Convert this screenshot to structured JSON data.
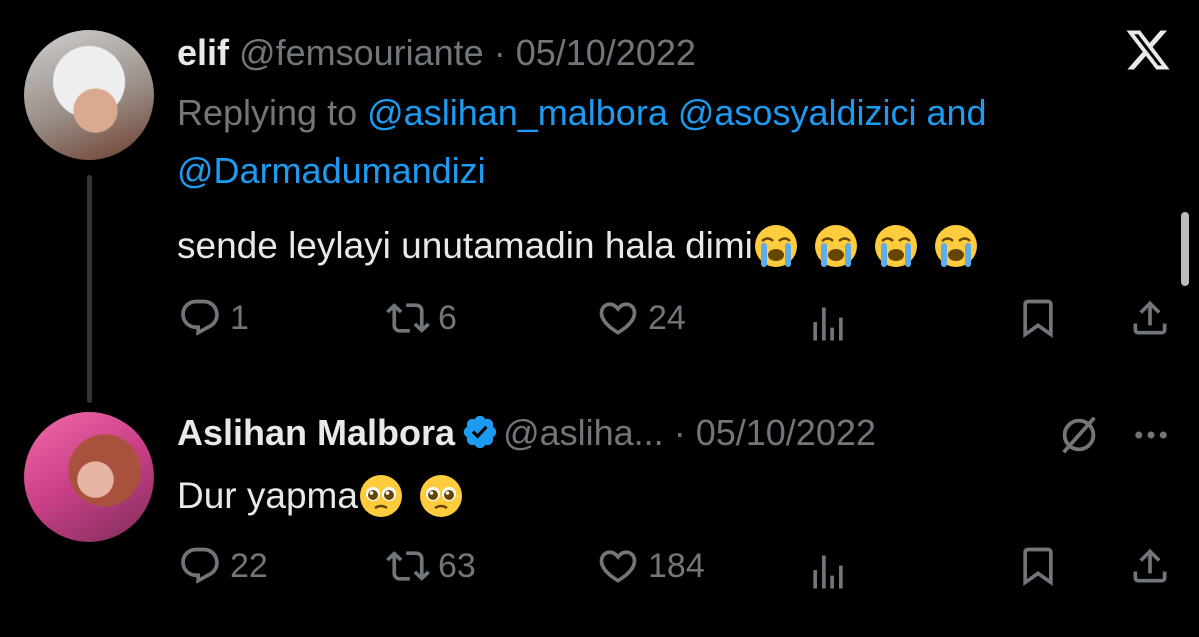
{
  "tweet1": {
    "name": "elif",
    "handle": "@femsouriante",
    "separator": "·",
    "date": "05/10/2022",
    "replying_prefix": "Replying to",
    "mention1": "@aslihan_malbora",
    "mention2": "@asosyaldizici",
    "mention_and": "and",
    "mention3": "@Darmadumandizi",
    "text": "sende leylayi unutamadin hala dimi",
    "emojis": [
      "loudly-crying-face",
      "loudly-crying-face",
      "loudly-crying-face",
      "loudly-crying-face"
    ],
    "replies": "1",
    "retweets": "6",
    "likes": "24"
  },
  "tweet2": {
    "name": "Aslihan Malbora",
    "handle": "@asliha...",
    "separator": "·",
    "date": "05/10/2022",
    "text": "Dur yapma",
    "emojis": [
      "pleading-face",
      "pleading-face"
    ],
    "replies": "22",
    "retweets": "63",
    "likes": "184"
  },
  "colors": {
    "background": "#000000",
    "text": "#e7e9ea",
    "muted": "#71767b",
    "accent": "#1d9bf0"
  },
  "icons": [
    "x-logo-icon",
    "reply-icon",
    "retweet-icon",
    "like-icon",
    "views-icon",
    "bookmark-icon",
    "share-icon",
    "verified-badge-icon",
    "grok-icon",
    "more-icon"
  ]
}
